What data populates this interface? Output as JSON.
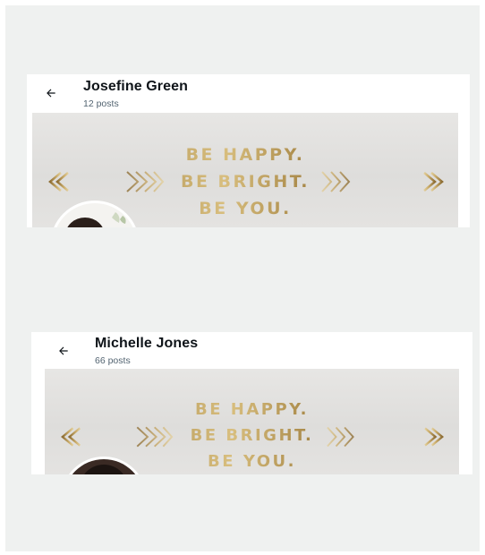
{
  "profiles": [
    {
      "name": "Josefine Green",
      "posts": "12 posts",
      "banner": {
        "lines": [
          "BE HAPPY.",
          "BE BRIGHT.",
          "BE YOU."
        ]
      }
    },
    {
      "name": "Michelle Jones",
      "posts": "66 posts",
      "banner": {
        "lines": [
          "BE HAPPY.",
          "BE BRIGHT.",
          "BE YOU."
        ]
      }
    }
  ],
  "icons": {
    "back": "arrow-left-icon",
    "decor": "gold-arrow-icon"
  },
  "colors": {
    "background": "#eff1f0",
    "name_text": "#0f1419",
    "meta_text": "#536471",
    "gold": "#b08d4a"
  }
}
